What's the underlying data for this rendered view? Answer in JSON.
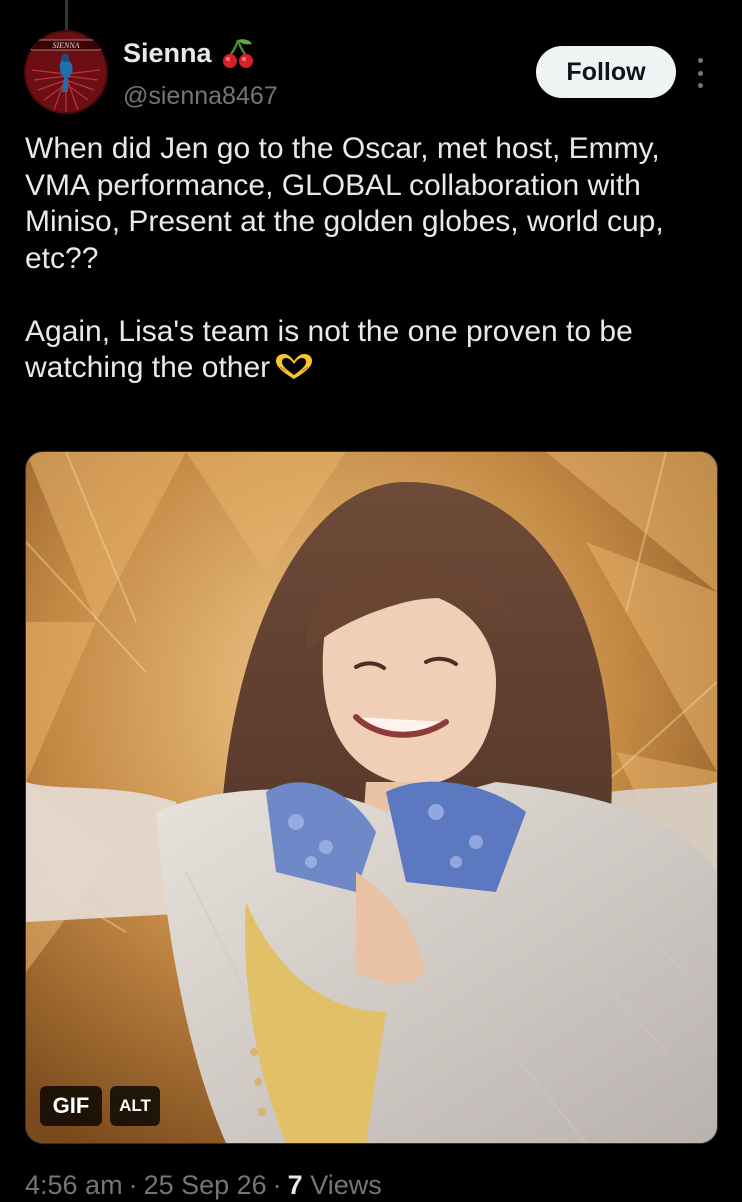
{
  "author": {
    "display_name": "Sienna",
    "name_emoji": "cherries-emoji",
    "handle": "@sienna8467",
    "avatar_text": "SIENNA"
  },
  "actions": {
    "follow_label": "Follow",
    "more_icon": "more-vertical-icon"
  },
  "tweet": {
    "paragraph_1": "When did Jen go to the Oscar, met host, Emmy, VMA performance, GLOBAL collaboration with Miniso, Present at the golden globes, world cup, etc??",
    "paragraph_2": "Again, Lisa's team is not the one proven to be watching the other",
    "trailing_emoji": "heart-hands-emoji"
  },
  "media": {
    "type": "gif",
    "gif_badge": "GIF",
    "alt_badge": "ALT"
  },
  "meta": {
    "time": "4:56 am",
    "date": "25 Sep 26",
    "views_count": "7",
    "views_label": "Views"
  },
  "colors": {
    "background": "#000000",
    "text_primary": "#e7e9ea",
    "text_secondary": "#71767b",
    "follow_bg": "#eff3f4",
    "follow_text": "#0f1419"
  }
}
